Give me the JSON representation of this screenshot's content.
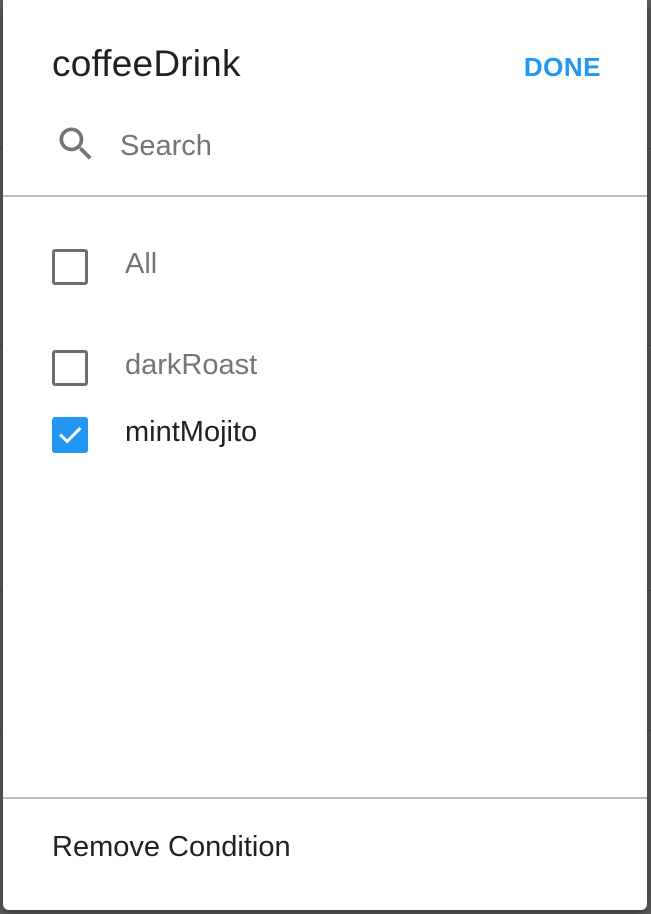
{
  "dialog": {
    "title": "coffeeDrink",
    "done_label": "DONE",
    "accent_color": "#2196f3"
  },
  "search": {
    "placeholder": "Search",
    "value": "",
    "icon": "search-icon"
  },
  "options": {
    "all": {
      "label": "All",
      "checked": false
    },
    "items": [
      {
        "label": "darkRoast",
        "checked": false
      },
      {
        "label": "mintMojito",
        "checked": true
      }
    ]
  },
  "footer": {
    "remove_label": "Remove Condition"
  }
}
